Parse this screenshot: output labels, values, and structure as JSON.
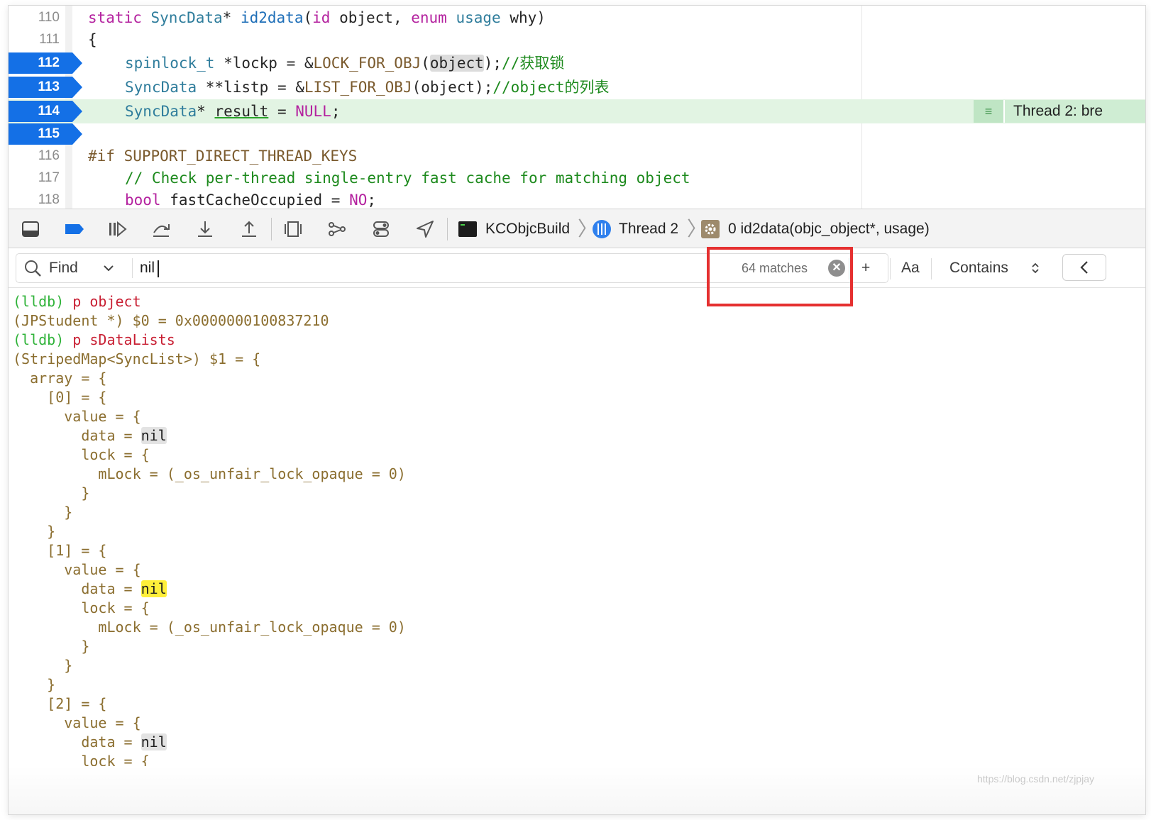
{
  "editor": {
    "lines": [
      {
        "num": "110",
        "breakpoint": false
      },
      {
        "num": "111",
        "breakpoint": false
      },
      {
        "num": "112",
        "breakpoint": true
      },
      {
        "num": "113",
        "breakpoint": true
      },
      {
        "num": "114",
        "breakpoint": true
      },
      {
        "num": "115",
        "breakpoint": true
      },
      {
        "num": "116",
        "breakpoint": false
      },
      {
        "num": "117",
        "breakpoint": false
      },
      {
        "num": "118",
        "breakpoint": false
      }
    ],
    "code": {
      "l110": {
        "t1": "static",
        "t2": "SyncData",
        "t3": "* ",
        "t4": "id2data",
        "t5": "(",
        "t6": "id",
        "t7": " object, ",
        "t8": "enum",
        "t9": " ",
        "t10": "usage",
        "t11": " why)"
      },
      "l111": {
        "t1": "{"
      },
      "l112": {
        "t1": "spinlock_t",
        "t2": " *lockp = &",
        "t3": "LOCK_FOR_OBJ",
        "t4": "(",
        "t5": "object",
        "t6": ");",
        "t7": "//获取锁"
      },
      "l113": {
        "t1": "SyncData",
        "t2": " **listp = &",
        "t3": "LIST_FOR_OBJ",
        "t4": "(object);",
        "t5": "//object的列表"
      },
      "l114": {
        "t1": "SyncData",
        "t2": "* ",
        "t3": "result",
        "t4": " = ",
        "t5": "NULL",
        "t6": ";"
      },
      "l116": {
        "t1": "#if",
        "t2": " SUPPORT_DIRECT_THREAD_KEYS"
      },
      "l117": {
        "t1": "// Check per-thread single-entry fast cache for matching object"
      },
      "l118": {
        "t1": "bool",
        "t2": " fastCacheOccupied = ",
        "t3": "NO",
        "t4": ";"
      }
    },
    "thread_badge": "Thread 2: bre"
  },
  "debugbar": {
    "breadcrumb": {
      "target": "KCObjcBuild",
      "thread": "Thread 2",
      "frame": "0 id2data(objc_object*, usage)"
    }
  },
  "findbar": {
    "mode": "Find",
    "query": "nil",
    "matches": "64 matches",
    "add_label": "+",
    "case_label": "Aa",
    "match_type": "Contains"
  },
  "console": {
    "l1": {
      "prompt": "(lldb)",
      "cmd": " p object"
    },
    "l2": "(JPStudent *) $0 = 0x0000000100837210",
    "l3": {
      "prompt": "(lldb)",
      "cmd": " p sDataLists"
    },
    "l4": "(StripedMap<SyncList>) $1 = {",
    "l5": "  array = {",
    "l6": "    [0] = {",
    "l7": "      value = {",
    "l8": {
      "pre": "        data = ",
      "nil": "nil"
    },
    "l9": "        lock = {",
    "l10": "          mLock = (_os_unfair_lock_opaque = 0)",
    "l11": "        }",
    "l12": "      }",
    "l13": "    }",
    "l14": "    [1] = {",
    "l15": "      value = {",
    "l16": {
      "pre": "        data = ",
      "nil": "nil"
    },
    "l17": "        lock = {",
    "l18": "          mLock = (_os_unfair_lock_opaque = 0)",
    "l19": "        }",
    "l20": "      }",
    "l21": "    }",
    "l22": "    [2] = {",
    "l23": "      value = {",
    "l24": {
      "pre": "        data = ",
      "nil": "nil"
    },
    "l25": "        lock = {"
  },
  "watermark": "https://blog.csdn.net/zjpjay",
  "colors": {
    "breakpoint": "#1470e6",
    "current_line": "#e2f4e3",
    "lldb_prompt": "#30b33a",
    "command": "#c81e32",
    "output": "#8b6e2f",
    "match_current": "#ffef3a",
    "annotation": "#e53030"
  }
}
